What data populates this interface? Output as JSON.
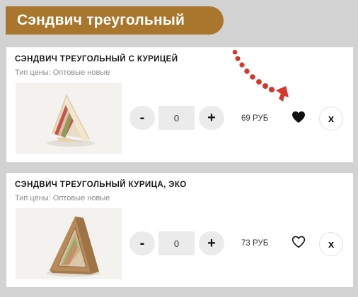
{
  "header": {
    "title": "Сэндвич треугольный"
  },
  "products": [
    {
      "name": "СЭНДВИЧ ТРЕУГОЛЬНЫЙ С КУРИЦЕЙ",
      "price_type": "Тип цены: Оптовые новые",
      "quantity": "0",
      "price": "69 РУБ",
      "favorite": true,
      "minus_label": "-",
      "plus_label": "+",
      "remove_label": "x"
    },
    {
      "name": "СЭНДВИЧ ТРЕУГОЛЬНЫЙ КУРИЦА, ЭКО",
      "price_type": "Тип цены: Оптовые новые",
      "quantity": "0",
      "price": "73 РУБ",
      "favorite": false,
      "minus_label": "-",
      "plus_label": "+",
      "remove_label": "x"
    }
  ],
  "colors": {
    "header_bg": "#a8762c",
    "page_bg": "#d2d2d2",
    "annotation_arrow": "#d9362b"
  },
  "icons": {
    "favorite_filled": "heart-filled-icon",
    "favorite_outline": "heart-outline-icon",
    "annotation": "dotted-arrow-icon"
  }
}
